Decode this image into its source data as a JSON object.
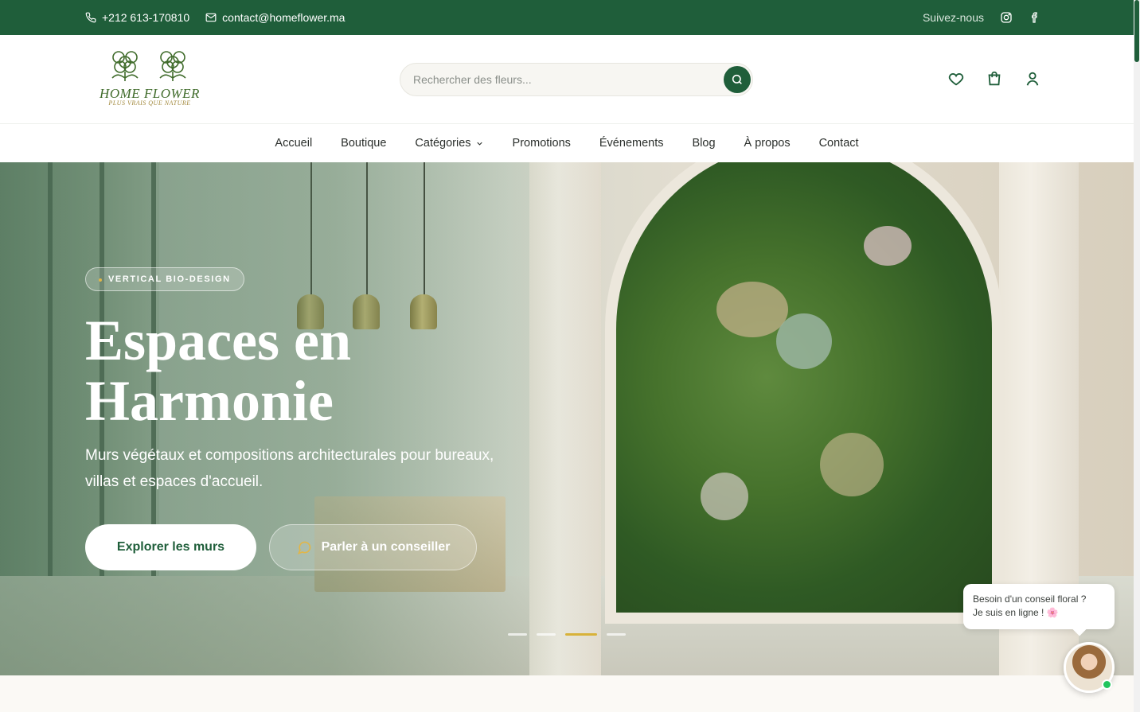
{
  "topbar": {
    "phone": "+212 613-170810",
    "email": "contact@homeflower.ma",
    "follow_label": "Suivez-nous",
    "social": [
      "instagram-icon",
      "facebook-icon"
    ]
  },
  "header": {
    "logo": {
      "brand": "HOME FLOWER",
      "tagline": "PLUS VRAIS QUE NATURE"
    },
    "search": {
      "placeholder": "Rechercher des fleurs..."
    },
    "icons": [
      "heart-icon",
      "cart-icon",
      "user-icon"
    ]
  },
  "nav": {
    "items": [
      {
        "label": "Accueil"
      },
      {
        "label": "Boutique"
      },
      {
        "label": "Catégories",
        "has_dropdown": true
      },
      {
        "label": "Promotions"
      },
      {
        "label": "Événements"
      },
      {
        "label": "Blog"
      },
      {
        "label": "À propos"
      },
      {
        "label": "Contact"
      }
    ]
  },
  "hero": {
    "badge": "VERTICAL BIO-DESIGN",
    "title": "Espaces en Harmonie",
    "subtitle": "Murs végétaux et compositions architecturales pour bureaux, villas et espaces d'accueil.",
    "primary_cta": "Explorer les murs",
    "secondary_cta": "Parler à un conseiller",
    "slides_count": 4,
    "active_slide": 3
  },
  "chat": {
    "line1": "Besoin d'un conseil floral ?",
    "line2": "Je suis en ligne ! 🌸",
    "status": "online"
  },
  "colors": {
    "brand_green": "#1f5e3a",
    "accent_gold": "#d8b23a",
    "online": "#22c55e"
  }
}
